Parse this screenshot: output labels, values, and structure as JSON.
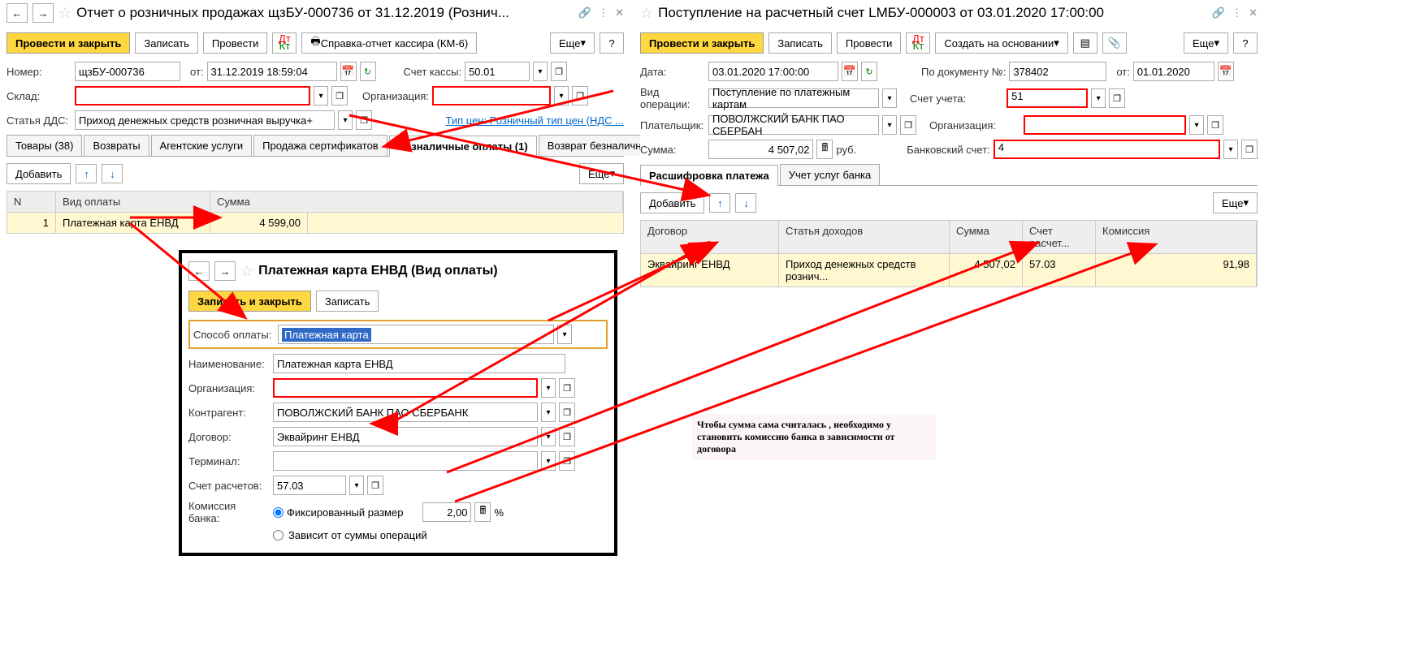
{
  "left": {
    "title": "Отчет о розничных продажах щзБУ-000736 от 31.12.2019 (Рознич...",
    "toolbar": {
      "process_close": "Провести и закрыть",
      "save": "Записать",
      "process": "Провести",
      "km6": "Справка-отчет кассира (КМ-6)",
      "more": "Еще"
    },
    "form": {
      "number_label": "Номер:",
      "number": "щзБУ-000736",
      "from_label": "от:",
      "date": "31.12.2019 18:59:04",
      "cash_account_label": "Счет кассы:",
      "cash_account": "50.01",
      "warehouse_label": "Склад:",
      "org_label": "Организация:",
      "dds_label": "Статья ДДС:",
      "dds": "Приход денежных средств розничная выручка+",
      "price_type_link": "Тип цен: Розничный тип цен (НДС ..."
    },
    "tabs": {
      "goods": "Товары (38)",
      "returns": "Возвраты",
      "agent": "Агентские услуги",
      "cert": "Продажа сертификатов",
      "nonCash": "Безналичные оплаты (1)",
      "nonCashReturn": "Возврат безналичной оплаты"
    },
    "subtoolbar": {
      "add": "Добавить",
      "more": "Еще"
    },
    "table": {
      "headers": {
        "n": "N",
        "type": "Вид оплаты",
        "sum": "Сумма"
      },
      "row": {
        "n": "1",
        "type": "Платежная карта ЕНВД",
        "sum": "4 599,00"
      }
    }
  },
  "right": {
    "title": "Поступление на расчетный счет LMБУ-000003 от 03.01.2020 17:00:00",
    "toolbar": {
      "process_close": "Провести и закрыть",
      "save": "Записать",
      "process": "Провести",
      "create_based": "Создать на основании",
      "more": "Еще"
    },
    "form": {
      "date_label": "Дата:",
      "date": "03.01.2020 17:00:00",
      "doc_num_label": "По документу №:",
      "doc_num": "378402",
      "from_label": "от:",
      "from_date": "01.01.2020",
      "op_type_label": "Вид операции:",
      "op_type": "Поступление по платежным картам",
      "account_label": "Счет учета:",
      "account": "51",
      "payer_label": "Плательщик:",
      "payer": "ПОВОЛЖСКИЙ БАНК ПАО СБЕРБАН",
      "org_label": "Организация:",
      "sum_label": "Сумма:",
      "sum": "4 507,02",
      "rub": "руб.",
      "bank_account_label": "Банковский счет:",
      "bank_account": "4"
    },
    "tabs": {
      "decode": "Расшифровка платежа",
      "bank_services": "Учет услуг банка"
    },
    "subtoolbar": {
      "add": "Добавить",
      "more": "Еще"
    },
    "table": {
      "headers": {
        "contract": "Договор",
        "income": "Статья доходов",
        "sum": "Сумма",
        "acc": "Счет расчет...",
        "comm": "Комиссия"
      },
      "row": {
        "contract": "Эквайринг ЕНВД",
        "income": "Приход денежных средств рознич...",
        "sum": "4 507,02",
        "acc": "57.03",
        "comm": "91,98"
      }
    }
  },
  "popup": {
    "title": "Платежная карта ЕНВД (Вид оплаты)",
    "toolbar": {
      "save_close": "Записать и закрыть",
      "save": "Записать"
    },
    "form": {
      "method_label": "Способ оплаты:",
      "method": "Платежная карта",
      "name_label": "Наименование:",
      "name": "Платежная карта ЕНВД",
      "org_label": "Организация:",
      "contractor_label": "Контрагент:",
      "contractor": "ПОВОЛЖСКИЙ БАНК ПАО СБЕРБАНК",
      "contract_label": "Договор:",
      "contract": "Эквайринг ЕНВД",
      "terminal_label": "Терминал:",
      "settlement_label": "Счет расчетов:",
      "settlement": "57.03",
      "comm_label": "Комиссия банка:",
      "radio1": "Фиксированный размер",
      "comm_value": "2,00",
      "percent": "%",
      "radio2": "Зависит от суммы операций"
    }
  },
  "annotation": "Чтобы сумма сама считалась , необходимо у становить комиссию банка в зависимости от договора"
}
